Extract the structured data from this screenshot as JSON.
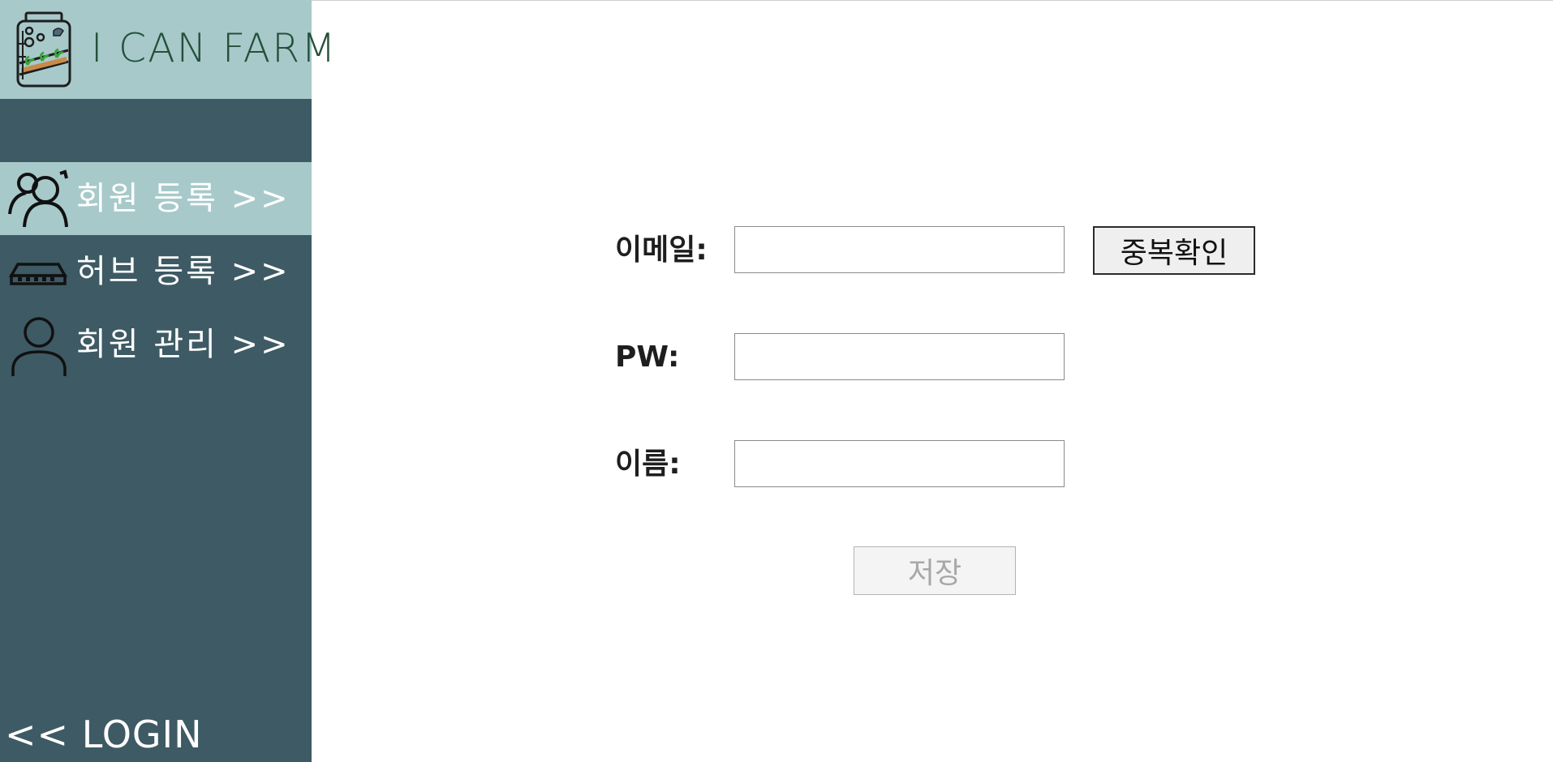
{
  "app": {
    "logo_text": "I CAN FARM"
  },
  "sidebar": {
    "items": [
      {
        "label": "회원 등록 >>",
        "icon": "users-icon",
        "active": true
      },
      {
        "label": "허브 등록 >>",
        "icon": "hub-icon",
        "active": false
      },
      {
        "label": "회원 관리 >>",
        "icon": "user-icon",
        "active": false
      }
    ],
    "login_link": "<< LOGIN"
  },
  "form": {
    "email_label": "이메일:",
    "email_value": "",
    "pw_label": "PW:",
    "pw_value": "",
    "name_label": "이름:",
    "name_value": "",
    "dup_check_label": "중복확인",
    "save_label": "저장"
  },
  "colors": {
    "sidebar_bg": "#3e5a64",
    "accent_bg": "#a8c9ca",
    "logo_text": "#23513a"
  }
}
